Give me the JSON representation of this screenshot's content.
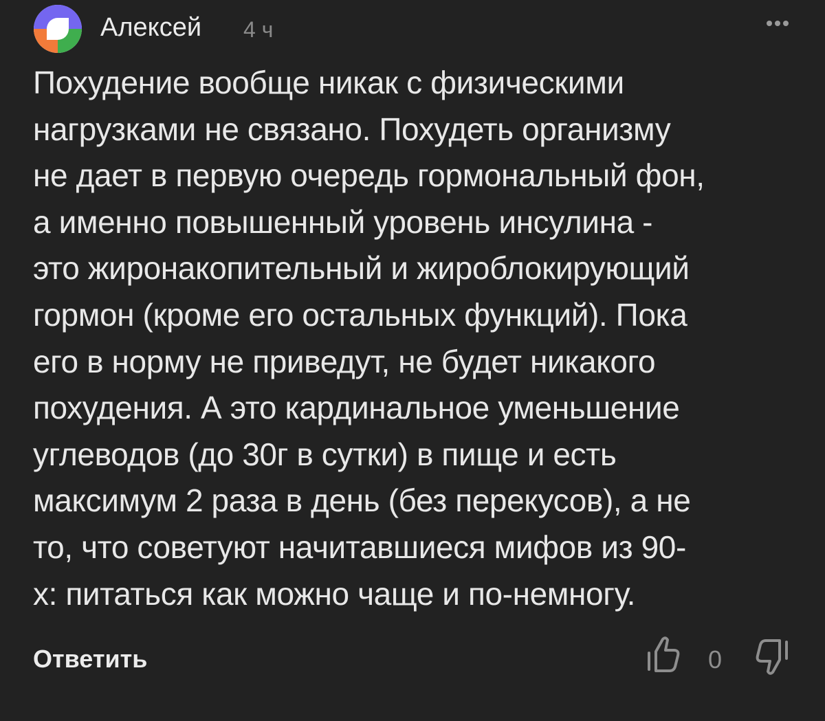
{
  "comment": {
    "author": "Алексей",
    "time": "4 ч",
    "body_lines": [
      "Похудение вообще никак с физическими",
      "нагрузками не связано. Похудеть организму",
      "не дает в первую очередь гормональный фон,",
      "а именно повышенный уровень инсулина -",
      "это жиронакопительный и жироблокирующий",
      "гормон (кроме его остальных функций). Пока",
      "его в норму не приведут, не будет никакого",
      "похудения. А это кардинальное уменьшение",
      "углеводов (до 30г в сутки) в пище и есть",
      "максимум 2 раза в день (без перекусов), а не",
      "то, что советуют начитавшиеся мифов из 90-",
      "х: питаться как можно чаще и по-немногу."
    ],
    "reply_label": "Ответить",
    "rating": "0"
  },
  "icons": {
    "avatar": "avatar-icon",
    "more": "more-dots-icon",
    "like": "thumbs-up-icon",
    "dislike": "thumbs-down-icon"
  },
  "colors": {
    "background": "#222222",
    "text": "#e8e8e8",
    "muted": "#8a8a8a",
    "avatar_purple": "#7466f0",
    "avatar_orange": "#f27b3a",
    "avatar_green": "#3fae4e",
    "avatar_center": "#ffffff"
  }
}
